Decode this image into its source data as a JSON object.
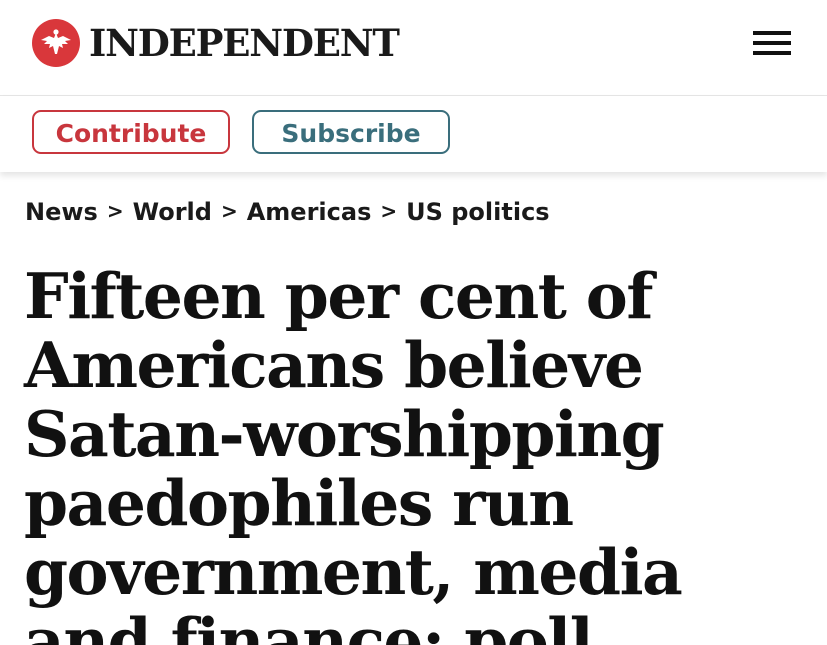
{
  "brand": {
    "name": "INDEPENDENT",
    "logo_icon": "eagle-icon",
    "logo_color": "#d9373b"
  },
  "header": {
    "menu_icon": "hamburger-menu-icon"
  },
  "actions": {
    "contribute_label": "Contribute",
    "subscribe_label": "Subscribe",
    "contribute_color": "#c8363d",
    "subscribe_color": "#3a6e7c"
  },
  "breadcrumb": {
    "items": [
      "News",
      "World",
      "Americas",
      "US politics"
    ],
    "separator": ">"
  },
  "article": {
    "headline": "Fifteen per cent of Americans believe Satan-worshipping paedophiles run government, media and finance: poll"
  }
}
